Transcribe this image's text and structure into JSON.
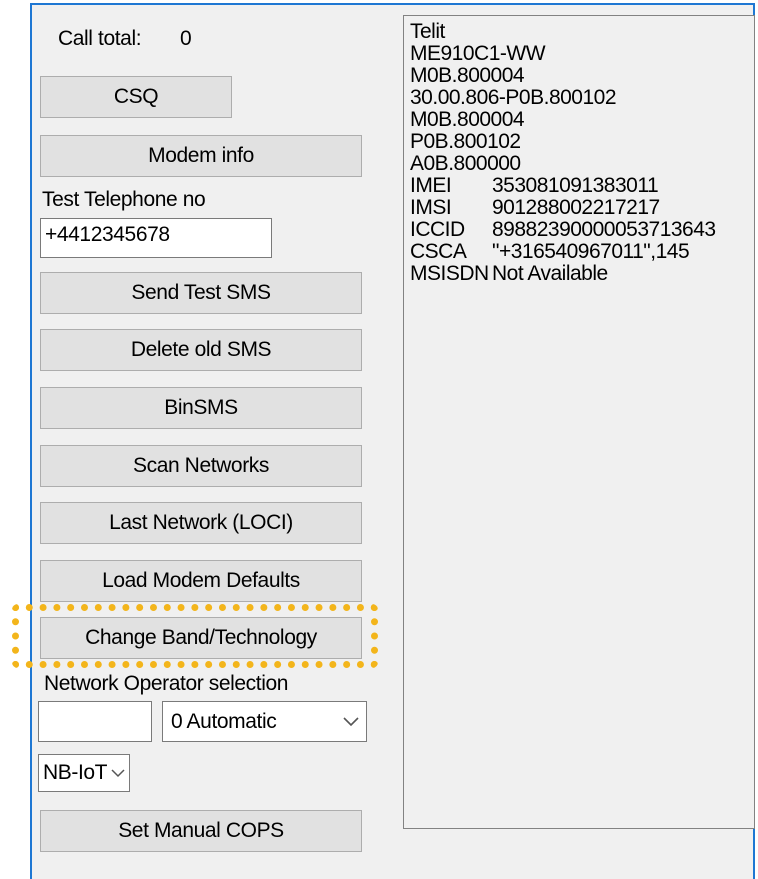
{
  "call_total": {
    "label": "Call total:",
    "value": "0"
  },
  "buttons": {
    "csq": "CSQ",
    "modem_info": "Modem info",
    "send_test_sms": "Send Test SMS",
    "delete_old_sms": "Delete old SMS",
    "binsms": "BinSMS",
    "scan_networks": "Scan Networks",
    "last_network": "Last Network (LOCI)",
    "load_modem_defaults": "Load Modem Defaults",
    "change_band": "Change Band/Technology",
    "set_manual_cops": "Set Manual COPS"
  },
  "test_phone": {
    "label": "Test Telephone no",
    "value": "+4412345678"
  },
  "network_operator": {
    "label": "Network Operator selection",
    "operator_value": "",
    "mode_selected": "0 Automatic",
    "technology_selected": "NB-IoT"
  },
  "output": {
    "lines": [
      "Telit",
      "ME910C1-WW",
      "M0B.800004",
      "30.00.806-P0B.800102",
      "M0B.800004",
      "P0B.800102",
      "A0B.800000"
    ],
    "fields": [
      {
        "key": "IMEI",
        "value": "353081091383011"
      },
      {
        "key": "IMSI",
        "value": "901288002217217"
      },
      {
        "key": "ICCID",
        "value": "89882390000053713643"
      },
      {
        "key": "CSCA",
        "value": "\"+316540967011\",145"
      },
      {
        "key": "MSISDN",
        "value": "Not Available"
      }
    ]
  },
  "highlight": {
    "target": "change_band",
    "color": "#f3b51b"
  },
  "colors": {
    "window_border": "#1e77d3",
    "button_face": "#e1e1e1",
    "panel_bg": "#f0f0f0"
  }
}
